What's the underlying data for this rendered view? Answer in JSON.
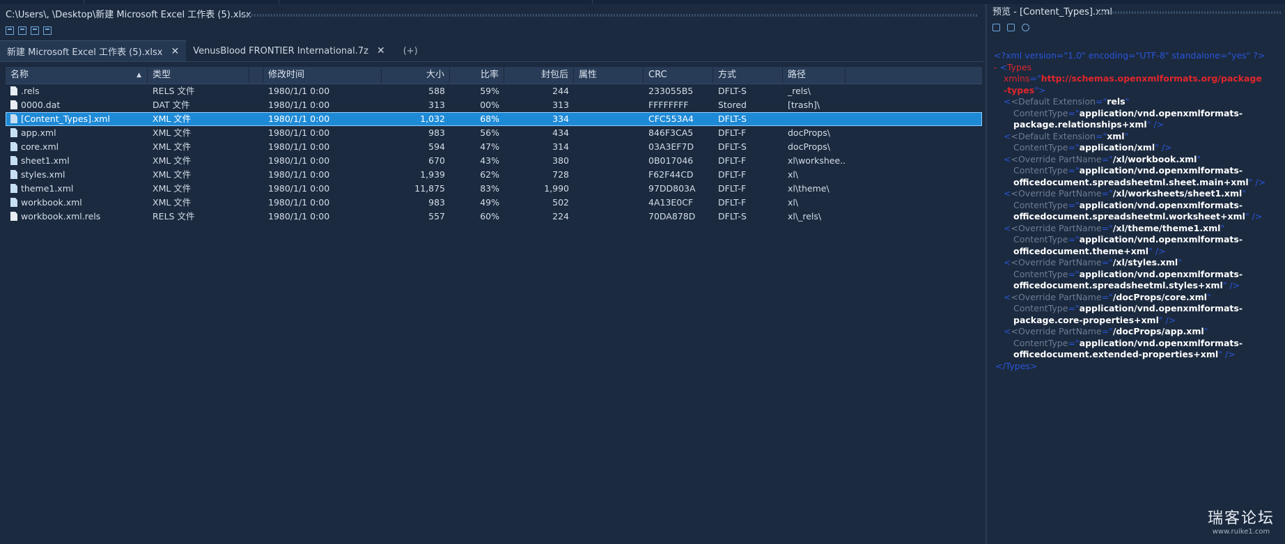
{
  "path": "C:\\Users\\,  \\Desktop\\新建 Microsoft Excel 工作表 (5).xlsx",
  "toolbar_icons": [
    "tree-view-icon",
    "panel-view-icon",
    "split-view-icon",
    "preview-icon"
  ],
  "tabs": [
    {
      "label": "新建 Microsoft Excel 工作表 (5).xlsx",
      "active": true,
      "close": "✕"
    },
    {
      "label": "VenusBlood FRONTIER International.7z",
      "active": false,
      "close": "✕"
    }
  ],
  "add_tab": "(+)",
  "columns": [
    "名称",
    "类型",
    "修改时间",
    "大小",
    "比率",
    "封包后",
    "属性",
    "CRC",
    "方式",
    "路径"
  ],
  "rows": [
    {
      "name": ".rels",
      "type": "RELS 文件",
      "modified": "1980/1/1 0:00",
      "size": "588",
      "ratio": "59%",
      "packed": "244",
      "attr": "",
      "crc": "233055B5",
      "method": "DFLT-S",
      "path": "_rels\\"
    },
    {
      "name": "0000.dat",
      "type": "DAT 文件",
      "modified": "1980/1/1 0:00",
      "size": "313",
      "ratio": "00%",
      "packed": "313",
      "attr": "",
      "crc": "FFFFFFFF",
      "method": "Stored",
      "path": "[trash]\\"
    },
    {
      "name": "[Content_Types].xml",
      "type": "XML 文件",
      "modified": "1980/1/1 0:00",
      "size": "1,032",
      "ratio": "68%",
      "packed": "334",
      "attr": "",
      "crc": "CFC553A4",
      "method": "DFLT-S",
      "path": ""
    },
    {
      "name": "app.xml",
      "type": "XML 文件",
      "modified": "1980/1/1 0:00",
      "size": "983",
      "ratio": "56%",
      "packed": "434",
      "attr": "",
      "crc": "846F3CA5",
      "method": "DFLT-F",
      "path": "docProps\\"
    },
    {
      "name": "core.xml",
      "type": "XML 文件",
      "modified": "1980/1/1 0:00",
      "size": "594",
      "ratio": "47%",
      "packed": "314",
      "attr": "",
      "crc": "03A3EF7D",
      "method": "DFLT-S",
      "path": "docProps\\"
    },
    {
      "name": "sheet1.xml",
      "type": "XML 文件",
      "modified": "1980/1/1 0:00",
      "size": "670",
      "ratio": "43%",
      "packed": "380",
      "attr": "",
      "crc": "0B017046",
      "method": "DFLT-F",
      "path": "xl\\workshee..."
    },
    {
      "name": "styles.xml",
      "type": "XML 文件",
      "modified": "1980/1/1 0:00",
      "size": "1,939",
      "ratio": "62%",
      "packed": "728",
      "attr": "",
      "crc": "F62F44CD",
      "method": "DFLT-F",
      "path": "xl\\"
    },
    {
      "name": "theme1.xml",
      "type": "XML 文件",
      "modified": "1980/1/1 0:00",
      "size": "11,875",
      "ratio": "83%",
      "packed": "1,990",
      "attr": "",
      "crc": "97DD803A",
      "method": "DFLT-F",
      "path": "xl\\theme\\"
    },
    {
      "name": "workbook.xml",
      "type": "XML 文件",
      "modified": "1980/1/1 0:00",
      "size": "983",
      "ratio": "49%",
      "packed": "502",
      "attr": "",
      "crc": "4A13E0CF",
      "method": "DFLT-F",
      "path": "xl\\"
    },
    {
      "name": "workbook.xml.rels",
      "type": "RELS 文件",
      "modified": "1980/1/1 0:00",
      "size": "557",
      "ratio": "60%",
      "packed": "224",
      "attr": "",
      "crc": "70DA878D",
      "method": "DFLT-S",
      "path": "xl\\_rels\\"
    }
  ],
  "selected_row": 2,
  "preview": {
    "title": "预览 - [Content_Types].xml",
    "decl": "<?xml version=\"1.0\" encoding=\"UTF-8\" standalone=\"yes\" ?>",
    "types_open": "- <Types",
    "xmlns_attr": "xmlns",
    "xmlns_val1": "http://schemas.openxmlformats.org/package",
    "xmlns_val2": "-types",
    "entries": [
      {
        "tag": "<Default Extension",
        "key_val": "rels",
        "attr2": "ContentType",
        "val_lines": [
          "application/vnd.openxmlformats-",
          "package.relationships+xml"
        ]
      },
      {
        "tag": "<Default Extension",
        "key_val": "xml",
        "attr2": "ContentType",
        "val_lines": [
          "application/xml"
        ]
      },
      {
        "tag": "<Override PartName",
        "key_val": "/xl/workbook.xml",
        "attr2": "ContentType",
        "val_lines": [
          "application/vnd.openxmlformats-",
          "officedocument.spreadsheetml.sheet.main+xml"
        ]
      },
      {
        "tag": "<Override PartName",
        "key_val": "/xl/worksheets/sheet1.xml",
        "attr2": "ContentType",
        "val_lines": [
          "application/vnd.openxmlformats-",
          "officedocument.spreadsheetml.worksheet+xml"
        ]
      },
      {
        "tag": "<Override PartName",
        "key_val": "/xl/theme/theme1.xml",
        "attr2": "ContentType",
        "val_lines": [
          "application/vnd.openxmlformats-",
          "officedocument.theme+xml"
        ]
      },
      {
        "tag": "<Override PartName",
        "key_val": "/xl/styles.xml",
        "attr2": "ContentType",
        "val_lines": [
          "application/vnd.openxmlformats-",
          "officedocument.spreadsheetml.styles+xml"
        ]
      },
      {
        "tag": "<Override PartName",
        "key_val": "/docProps/core.xml",
        "attr2": "ContentType",
        "val_lines": [
          "application/vnd.openxmlformats-",
          "package.core-properties+xml"
        ]
      },
      {
        "tag": "<Override PartName",
        "key_val": "/docProps/app.xml",
        "attr2": "ContentType",
        "val_lines": [
          "application/vnd.openxmlformats-",
          "officedocument.extended-properties+xml"
        ]
      }
    ],
    "types_close": "</Types>"
  },
  "watermark": {
    "main": "瑞客论坛",
    "sub": "www.ruike1.com"
  }
}
